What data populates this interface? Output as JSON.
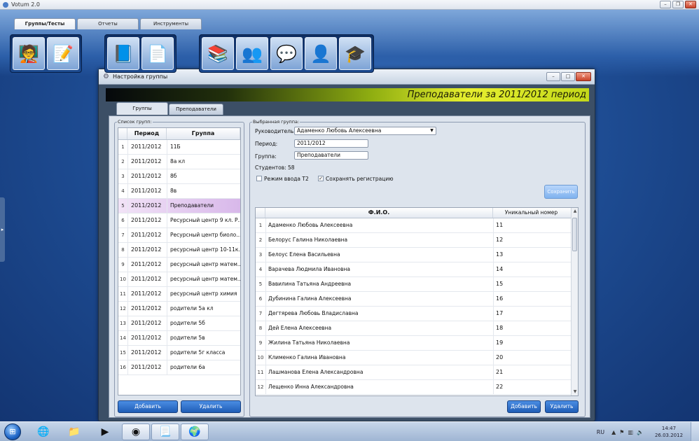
{
  "app": {
    "title": "Votum 2.0",
    "tabs": [
      "Группы/Тесты",
      "Отчеты",
      "Инструменты"
    ],
    "toolbar_icons": [
      [
        "teacher-card-icon",
        "edit-document-icon"
      ],
      [
        "folder-icon",
        "blank-document-icon"
      ],
      [
        "chalkboard-icon",
        "users-pair-icon",
        "chat-bubble-icon",
        "person-icon",
        "graduate-icon"
      ]
    ]
  },
  "dialog": {
    "title": "Настройка группы",
    "banner": "Преподаватели за 2011/2012 период",
    "tabs": [
      "Группы",
      "Преподаватели"
    ],
    "group_list": {
      "caption": "Список групп:",
      "columns": [
        "Период",
        "Группа"
      ],
      "selected_index": 4,
      "rows": [
        {
          "n": "1",
          "period": "2011/2012",
          "group": "11Б"
        },
        {
          "n": "2",
          "period": "2011/2012",
          "group": "8а кл"
        },
        {
          "n": "3",
          "period": "2011/2012",
          "group": "8б"
        },
        {
          "n": "4",
          "period": "2011/2012",
          "group": "8в"
        },
        {
          "n": "5",
          "period": "2011/2012",
          "group": "Преподаватели"
        },
        {
          "n": "6",
          "period": "2011/2012",
          "group": "Ресурсный центр 9 кл. Р..."
        },
        {
          "n": "7",
          "period": "2011/2012",
          "group": "Ресурсный центр биоло..."
        },
        {
          "n": "8",
          "period": "2011/2012",
          "group": "ресурсный центр 10-11к..."
        },
        {
          "n": "9",
          "period": "2011/2012",
          "group": "ресурсный центр матем..."
        },
        {
          "n": "10",
          "period": "2011/2012",
          "group": "ресурсный центр матем..."
        },
        {
          "n": "11",
          "period": "2011/2012",
          "group": "ресурсный центр химия"
        },
        {
          "n": "12",
          "period": "2011/2012",
          "group": "родители 5а кл"
        },
        {
          "n": "13",
          "period": "2011/2012",
          "group": "родители 5б"
        },
        {
          "n": "14",
          "period": "2011/2012",
          "group": "родители 5в"
        },
        {
          "n": "15",
          "period": "2011/2012",
          "group": "родители 5г класса"
        },
        {
          "n": "16",
          "period": "2011/2012",
          "group": "родители 6а"
        }
      ],
      "add_label": "Добавить",
      "delete_label": "Удалить"
    },
    "selected_group": {
      "caption": "Выбранная группа:",
      "leader_label": "Руководитель:",
      "leader_value": "Адаменко Любовь Алексеевна",
      "period_label": "Период:",
      "period_value": "2011/2012",
      "group_label": "Группа:",
      "group_value": "Преподаватели",
      "students_label": "Студентов: 58",
      "t2_mode_label": "Режим ввода T2",
      "t2_mode_checked": false,
      "keep_registration_label": "Сохранять регистрацию",
      "keep_registration_checked": true,
      "save_label": "Сохранить",
      "columns": [
        "Ф.И.О.",
        "Уникальный номер"
      ],
      "rows": [
        {
          "n": "1",
          "name": "Адаменко Любовь Алексеевна",
          "id": "11"
        },
        {
          "n": "2",
          "name": "Белорус Галина Николаевна",
          "id": "12"
        },
        {
          "n": "3",
          "name": "Белоус Елена Васильевна",
          "id": "13"
        },
        {
          "n": "4",
          "name": "Варачева Людмила Ивановна",
          "id": "14"
        },
        {
          "n": "5",
          "name": "Вавилина Татьяна Андреевна",
          "id": "15"
        },
        {
          "n": "6",
          "name": "Дубинина Галина Алексеевна",
          "id": "16"
        },
        {
          "n": "7",
          "name": "Дегтярева Любовь Владиславна",
          "id": "17"
        },
        {
          "n": "8",
          "name": "Дей Елена Алексеевна",
          "id": "18"
        },
        {
          "n": "9",
          "name": "Жилина Татьяна Николаевна",
          "id": "19"
        },
        {
          "n": "10",
          "name": "Клименко Галина Ивановна",
          "id": "20"
        },
        {
          "n": "11",
          "name": "Лашманова Елена Александровна",
          "id": "21"
        },
        {
          "n": "12",
          "name": "Лещенко Инна Александровна",
          "id": "22"
        }
      ],
      "add_label": "Добавить",
      "delete_label": "Удалить"
    }
  },
  "taskbar": {
    "language": "RU",
    "time": "14:47",
    "date": "26.03.2012",
    "items": [
      "start-orb",
      "ie-icon",
      "explorer-icon",
      "media-player-icon",
      "chrome-icon",
      "word-icon",
      "votum-icon"
    ]
  }
}
